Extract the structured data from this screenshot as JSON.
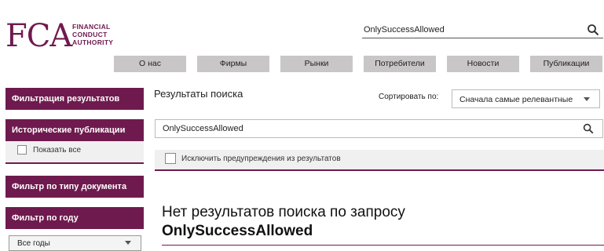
{
  "logo": {
    "letters": "FCA",
    "lines": [
      "FINANCIAL",
      "CONDUCT",
      "AUTHORITY"
    ]
  },
  "header": {
    "search_value": "OnlySuccessAllowed",
    "search_icon": "search-icon"
  },
  "nav": {
    "items": [
      "О нас",
      "Фирмы",
      "Рынки",
      "Потребители",
      "Новости",
      "Публикации"
    ]
  },
  "sidebar": {
    "filter_results": "Фильтрация результатов",
    "historical_publications": "Исторические публикации",
    "show_all": "Показать все",
    "doc_type_filter": "Фильтр по типу документа",
    "year_filter": "Фильтр по году",
    "year_select_value": "Все годы"
  },
  "main": {
    "title": "Результаты поиска",
    "sort_label": "Сортировать по:",
    "sort_value": "Сначала самые релевантные",
    "search_value": "OnlySuccessAllowed",
    "exclude_label": "Исключить предупреждения из результатов",
    "no_results_line1": "Нет результатов поиска по запросу",
    "no_results_query": "OnlySuccessAllowed"
  },
  "colors": {
    "brand": "#6f1a4f",
    "nav_bg": "#c8c6c6",
    "panel_bg": "#f0f0f0"
  }
}
